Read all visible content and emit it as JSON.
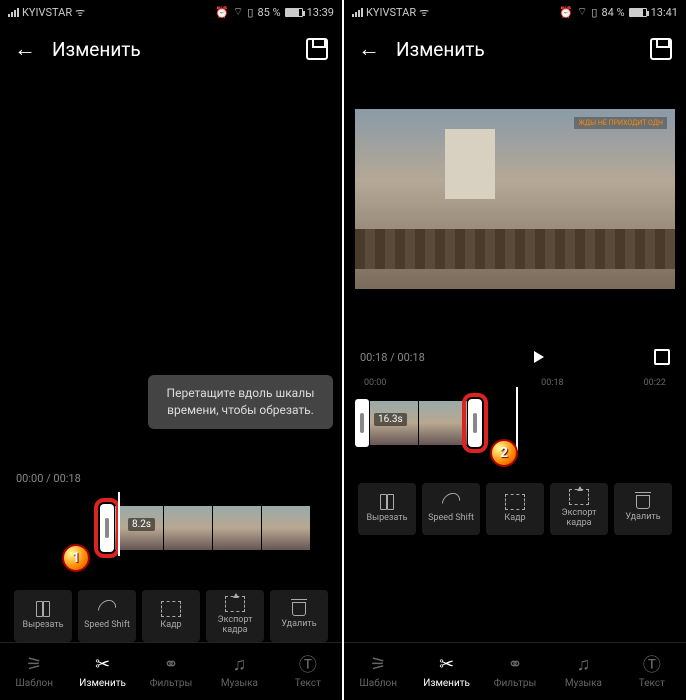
{
  "left": {
    "status": {
      "carrier": "KYIVSTAR",
      "battery": "85 %",
      "time": "13:39"
    },
    "title": "Изменить",
    "timecode": "00:00 / 00:18",
    "tooltip": "Перетащите вдоль шкалы времени, чтобы обрезать.",
    "clip_duration": "8.2s",
    "badge": "1"
  },
  "right": {
    "status": {
      "carrier": "KYIVSTAR",
      "battery": "84 %",
      "time": "13:41"
    },
    "title": "Изменить",
    "timecode": "00:18 / 00:18",
    "ruler": [
      "00:00",
      "00:18",
      "00:22"
    ],
    "clip_duration": "16.3s",
    "badge": "2"
  },
  "tools": [
    {
      "name": "cut",
      "label": "Вырезать"
    },
    {
      "name": "speed",
      "label": "Speed Shift"
    },
    {
      "name": "frame",
      "label": "Кадр"
    },
    {
      "name": "export",
      "label": "Экспорт кадра"
    },
    {
      "name": "delete",
      "label": "Удалить"
    }
  ],
  "nav": [
    {
      "name": "template",
      "label": "Шаблон"
    },
    {
      "name": "edit",
      "label": "Изменить"
    },
    {
      "name": "filters",
      "label": "Фильтры"
    },
    {
      "name": "music",
      "label": "Музыка"
    },
    {
      "name": "text",
      "label": "Текст"
    }
  ]
}
